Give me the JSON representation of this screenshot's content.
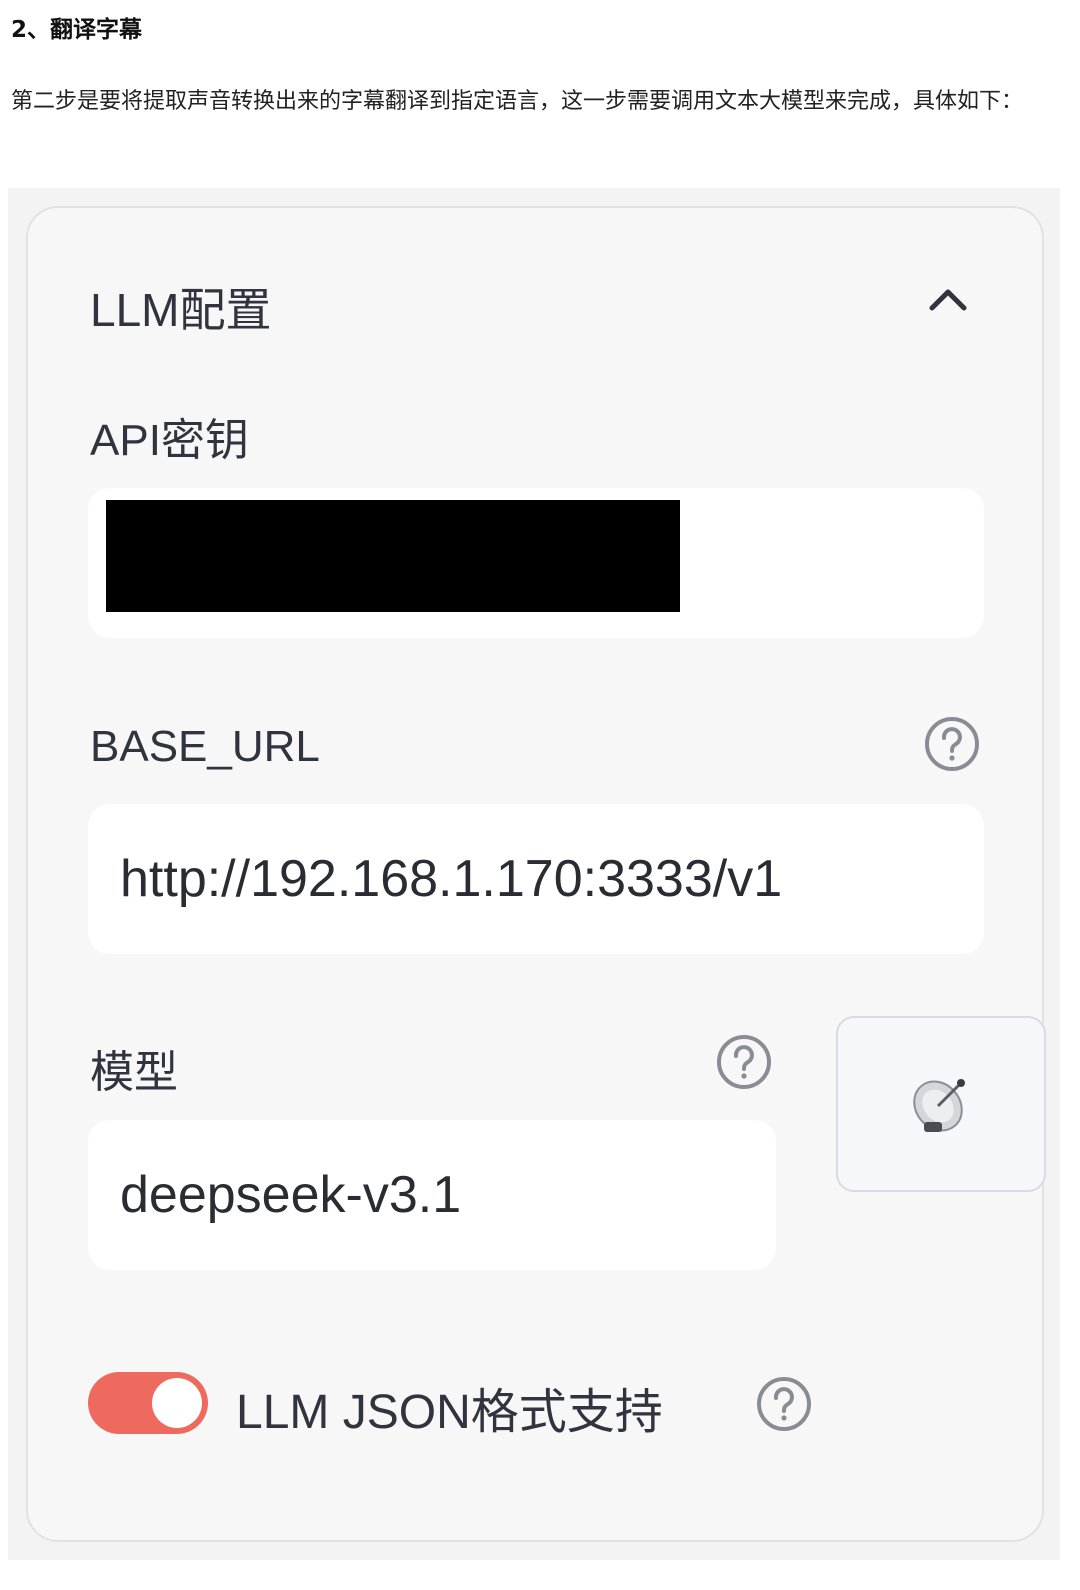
{
  "article": {
    "heading": "2、翻译字幕",
    "paragraph": "第二步是要将提取声音转换出来的字幕翻译到指定语言，这一步需要调用文本大模型来完成，具体如下："
  },
  "panel": {
    "title": "LLM配置",
    "api_key": {
      "label": "API密钥"
    },
    "base_url": {
      "label": "BASE_URL",
      "value": "http://192.168.1.170:3333/v1"
    },
    "model": {
      "label": "模型",
      "value": "deepseek-v3.1"
    },
    "json_support": {
      "label": "LLM JSON格式支持",
      "enabled": true
    }
  },
  "icons": {
    "collapse": "chevron-up-icon",
    "help": "question-circle-icon",
    "fetch_models": "satellite-dish-icon"
  },
  "colors": {
    "toggle_on": "#ee6a5e",
    "card_background": "#f7f7f8",
    "input_background": "#ffffff",
    "text": "#31333f"
  }
}
